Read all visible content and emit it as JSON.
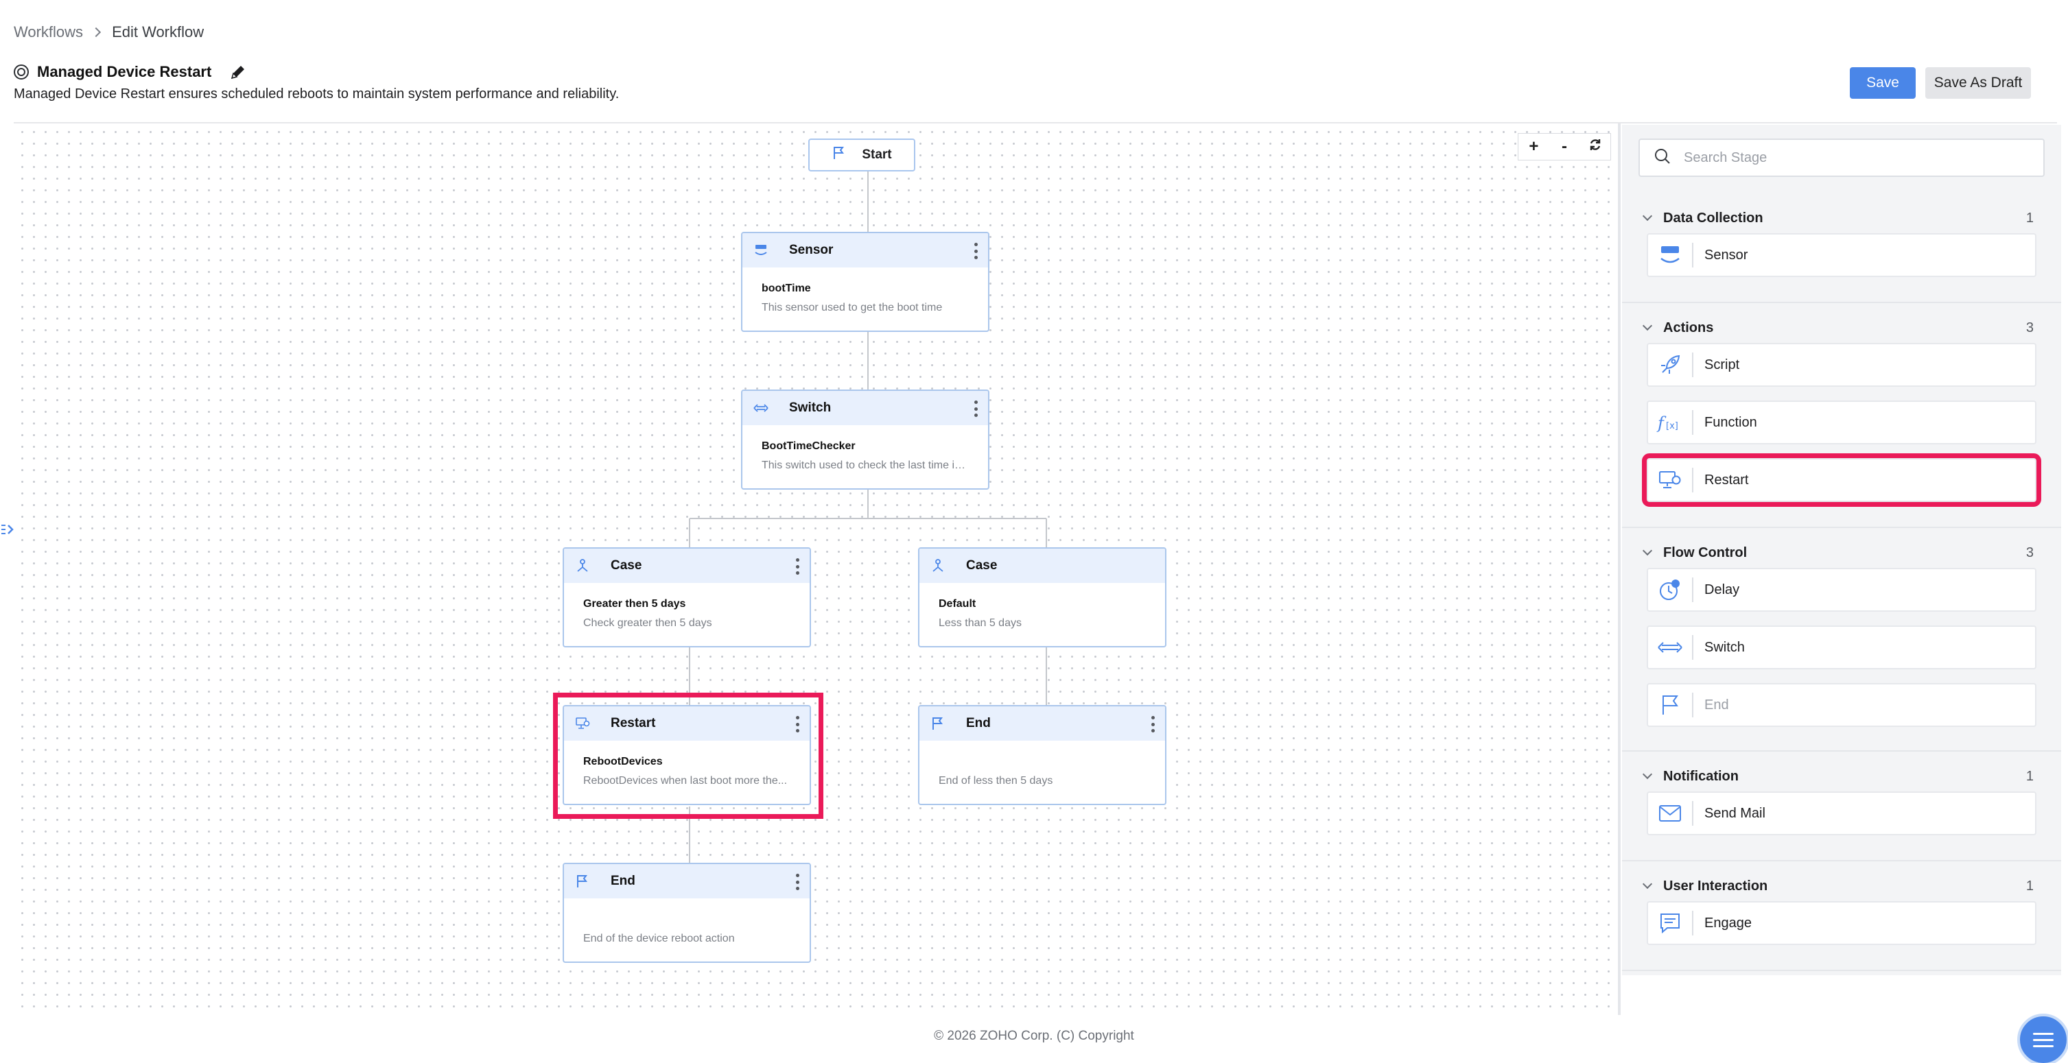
{
  "breadcrumb": {
    "root": "Workflows",
    "current": "Edit Workflow"
  },
  "workflow": {
    "title": "Managed Device Restart",
    "description": "Managed Device Restart ensures scheduled reboots to maintain system performance and reliability."
  },
  "actions": {
    "save": "Save",
    "save_draft": "Save As Draft"
  },
  "zoom": {
    "in": "+",
    "out": "-",
    "reset": "⟳"
  },
  "canvas": {
    "start": "Start",
    "nodes": [
      {
        "type": "Sensor",
        "name": "bootTime",
        "desc": "This sensor used to get the boot time"
      },
      {
        "type": "Switch",
        "name": "BootTimeChecker",
        "desc": "This switch used to check the last time is..."
      },
      {
        "type": "Case",
        "name": "Greater then 5 days",
        "desc": "Check greater then 5 days"
      },
      {
        "type": "Case",
        "name": "Default",
        "desc": "Less than 5 days"
      },
      {
        "type": "Restart",
        "name": "RebootDevices",
        "desc": "RebootDevices when last boot more the..."
      },
      {
        "type": "End",
        "name": "",
        "desc": "End of less then 5 days"
      },
      {
        "type": "End",
        "name": "",
        "desc": "End of the device reboot action"
      }
    ]
  },
  "panel": {
    "search_placeholder": "Search Stage",
    "sections": [
      {
        "title": "Data Collection",
        "count": "1",
        "items": [
          "Sensor"
        ]
      },
      {
        "title": "Actions",
        "count": "3",
        "items": [
          "Script",
          "Function",
          "Restart"
        ]
      },
      {
        "title": "Flow Control",
        "count": "3",
        "items": [
          "Delay",
          "Switch",
          "End"
        ]
      },
      {
        "title": "Notification",
        "count": "1",
        "items": [
          "Send Mail"
        ]
      },
      {
        "title": "User Interaction",
        "count": "1",
        "items": [
          "Engage"
        ]
      }
    ]
  },
  "footer": "© 2026 ZOHO Corp. (C) Copyright",
  "colors": {
    "accent": "#4a86e8",
    "highlight": "#ea1a59",
    "node_border": "#aac6ec",
    "node_header": "#e8f0fd"
  }
}
